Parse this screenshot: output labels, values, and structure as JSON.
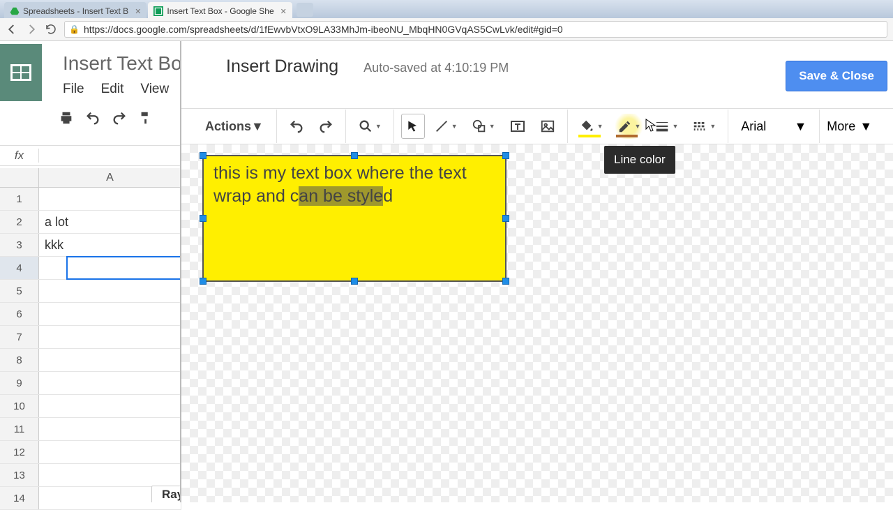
{
  "browser": {
    "tabs": [
      {
        "title": "Spreadsheets - Insert Text B"
      },
      {
        "title": "Insert Text Box - Google She"
      }
    ],
    "url": "https://docs.google.com/spreadsheets/d/1fEwvbVtxO9LA33MhJm-ibeoNU_MbqHN0GVqAS5CwLvk/edit#gid=0"
  },
  "sheets": {
    "doc_title": "Insert Text Bo",
    "menu": {
      "file": "File",
      "edit": "Edit",
      "view": "View"
    },
    "col_header": "A",
    "rows": [
      "1",
      "2",
      "3",
      "4",
      "5",
      "6",
      "7",
      "8",
      "9",
      "10",
      "11",
      "12",
      "13",
      "14"
    ],
    "cells": {
      "a2": "a lot",
      "a3": "kkk"
    },
    "sheet_tab": "Ray"
  },
  "drawing": {
    "title": "Insert Drawing",
    "autosave": "Auto-saved at 4:10:19 PM",
    "save_close": "Save & Close",
    "actions": "Actions",
    "font": "Arial",
    "more": "More",
    "tooltip": "Line color",
    "textbox": {
      "pre": "this is my text box where the text wrap and c",
      "sel": "an be style",
      "post": "d"
    }
  }
}
